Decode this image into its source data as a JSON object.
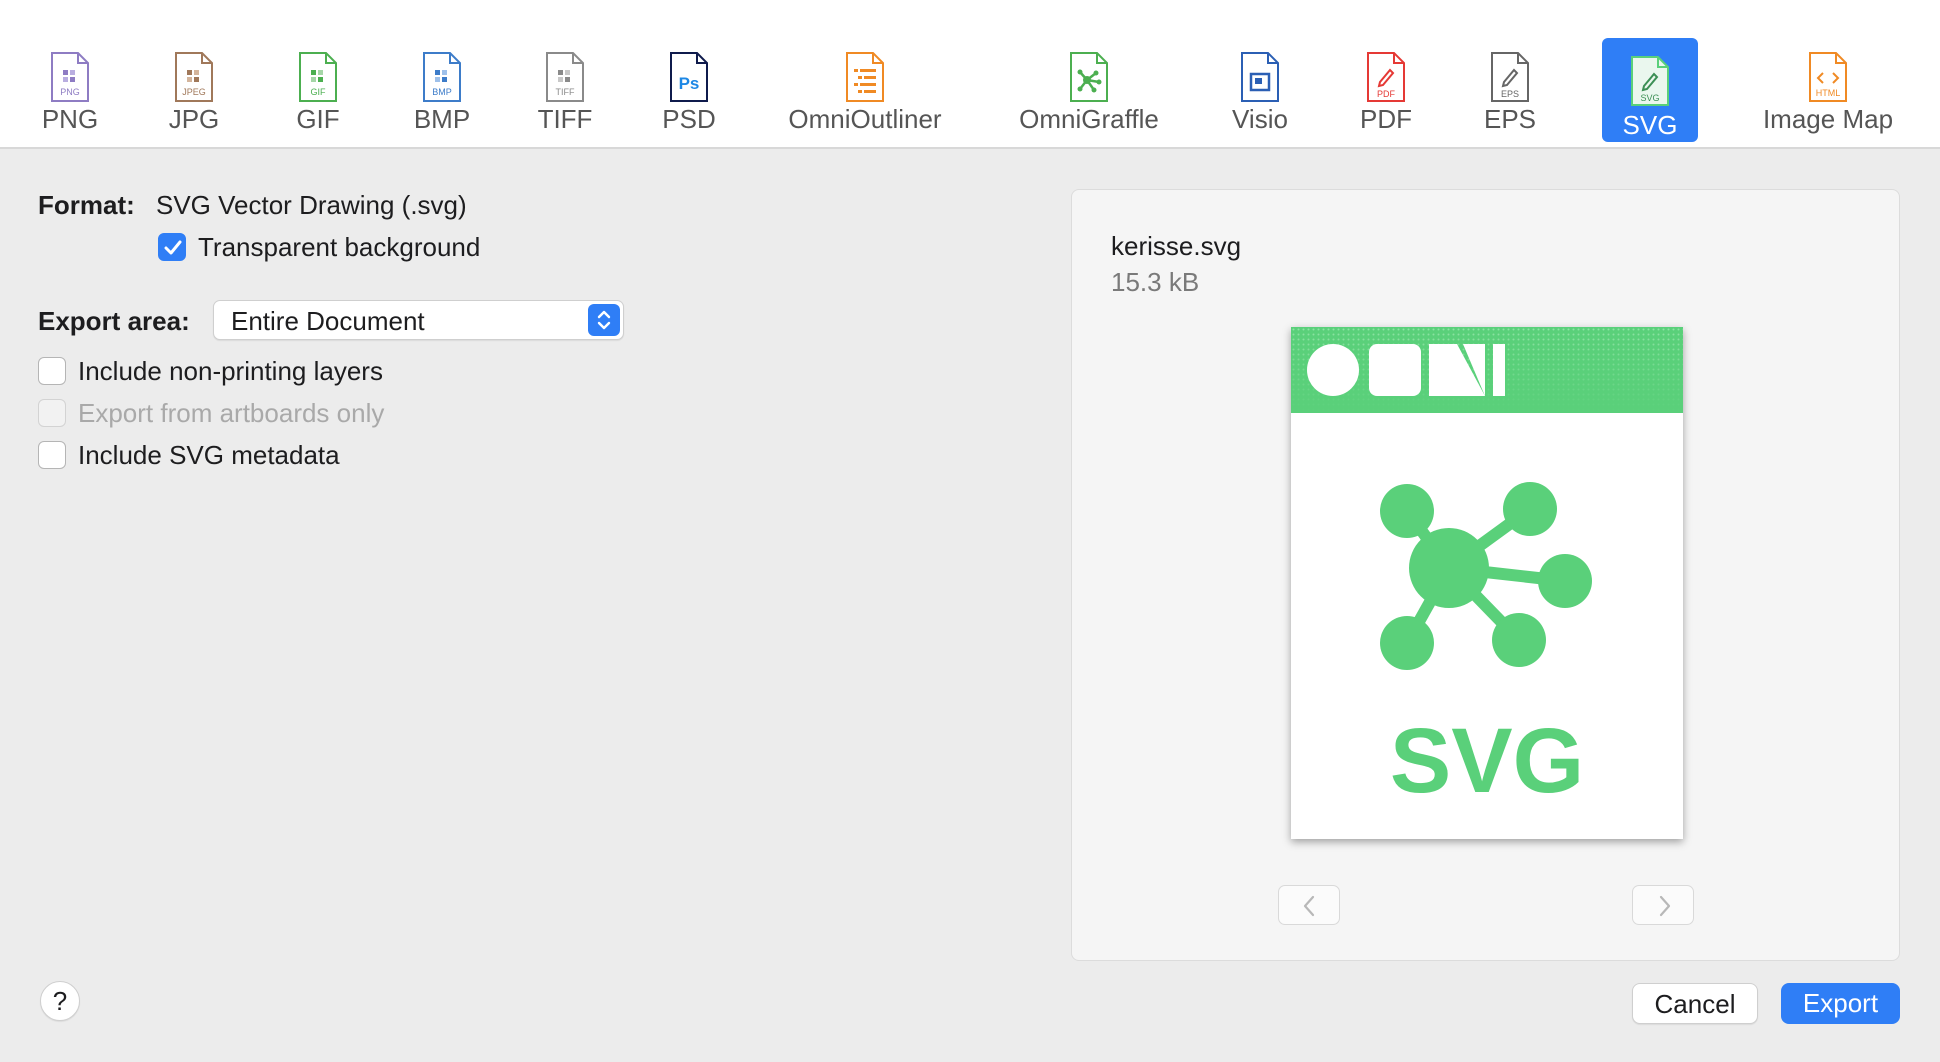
{
  "formats": [
    {
      "key": "png",
      "label": "PNG",
      "badge": "PNG",
      "color": "#8e7cc3"
    },
    {
      "key": "jpg",
      "label": "JPG",
      "badge": "JPEG",
      "color": "#a0785a"
    },
    {
      "key": "gif",
      "label": "GIF",
      "badge": "GIF",
      "color": "#4caf50"
    },
    {
      "key": "bmp",
      "label": "BMP",
      "badge": "BMP",
      "color": "#3d7cc9"
    },
    {
      "key": "tiff",
      "label": "TIFF",
      "badge": "TIFF",
      "color": "#8a8a8a"
    },
    {
      "key": "psd",
      "label": "PSD",
      "badge": "Ps",
      "color": "#1e88e5"
    },
    {
      "key": "omnioutliner",
      "label": "OmniOutliner",
      "badge": "",
      "color": "#f08a24"
    },
    {
      "key": "omnigraffle",
      "label": "OmniGraffle",
      "badge": "",
      "color": "#4caf50"
    },
    {
      "key": "visio",
      "label": "Visio",
      "badge": "",
      "color": "#2b5fb4"
    },
    {
      "key": "pdf",
      "label": "PDF",
      "badge": "PDF",
      "color": "#e53935"
    },
    {
      "key": "eps",
      "label": "EPS",
      "badge": "EPS",
      "color": "#666666"
    },
    {
      "key": "svg",
      "label": "SVG",
      "badge": "SVG",
      "color": "#5ad07a",
      "selected": true
    },
    {
      "key": "imagemap",
      "label": "Image Map",
      "badge": "HTML",
      "color": "#f08a24"
    }
  ],
  "options": {
    "format_label": "Format:",
    "format_value": "SVG Vector Drawing (.svg)",
    "transparent_bg": {
      "label": "Transparent background",
      "checked": true
    },
    "export_area_label": "Export area:",
    "export_area_value": "Entire Document",
    "include_nonprinting": {
      "label": "Include non-printing layers",
      "checked": false
    },
    "artboards_only": {
      "label": "Export from artboards only",
      "checked": false,
      "disabled": true
    },
    "svg_metadata": {
      "label": "Include SVG metadata",
      "checked": false
    }
  },
  "preview": {
    "filename": "kerisse.svg",
    "filesize": "15.3 kB",
    "thumb_text": "SVG",
    "accent": "#5ad07a"
  },
  "buttons": {
    "help": "?",
    "cancel": "Cancel",
    "export": "Export"
  },
  "colors": {
    "accent": "#2f7ef6"
  }
}
